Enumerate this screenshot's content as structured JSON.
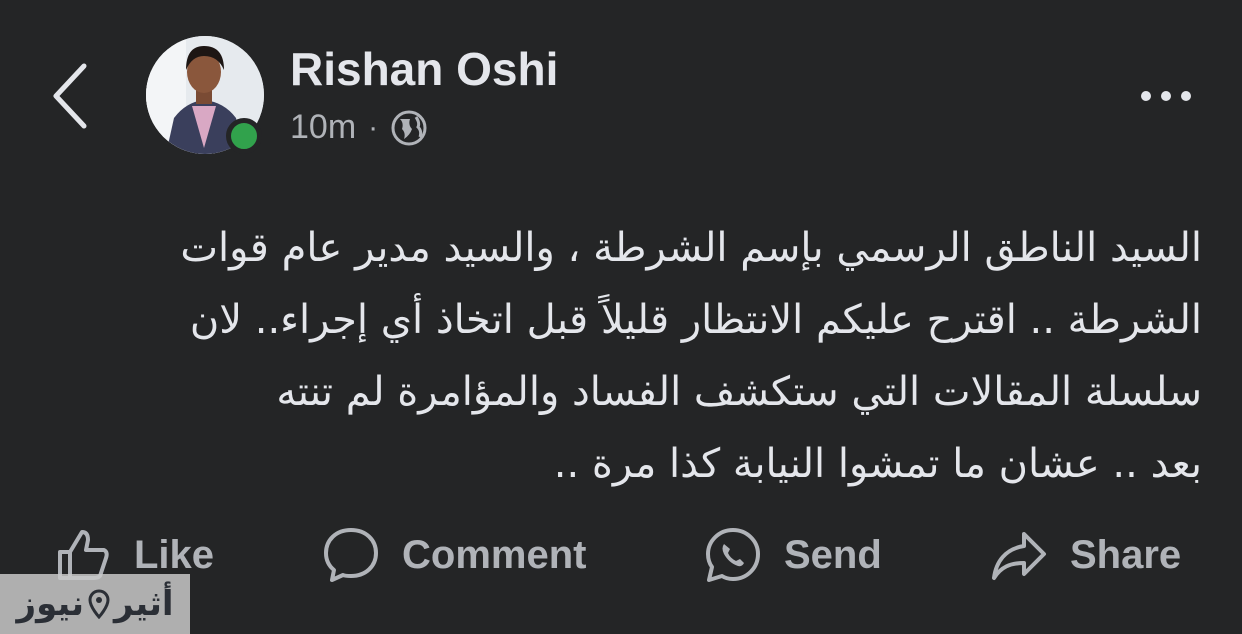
{
  "header": {
    "name": "Rishan Oshi",
    "time": "10m",
    "separator": "·",
    "privacy_icon": "globe-icon",
    "back_icon": "chevron-left-icon",
    "more_icon": "more-horizontal-icon",
    "online_color": "#31a24c"
  },
  "post": {
    "lines": [
      "السيد الناطق الرسمي بإسم الشرطة ، والسيد مدير عام قوات",
      "الشرطة .. اقترح عليكم الانتظار قليلاً قبل اتخاذ أي إجراء.. لان",
      "سلسلة المقالات التي ستكشف الفساد والمؤامرة لم تنته",
      "بعد .. عشان ما تمشوا النيابة كذا مرة .."
    ]
  },
  "actions": {
    "like": "Like",
    "comment": "Comment",
    "send": "Send",
    "share": "Share"
  },
  "watermark": {
    "word1": "أثير",
    "word2": "نيوز"
  },
  "colors": {
    "background": "#242526",
    "text": "#e4e6eb",
    "secondary": "#b0b3b8"
  }
}
